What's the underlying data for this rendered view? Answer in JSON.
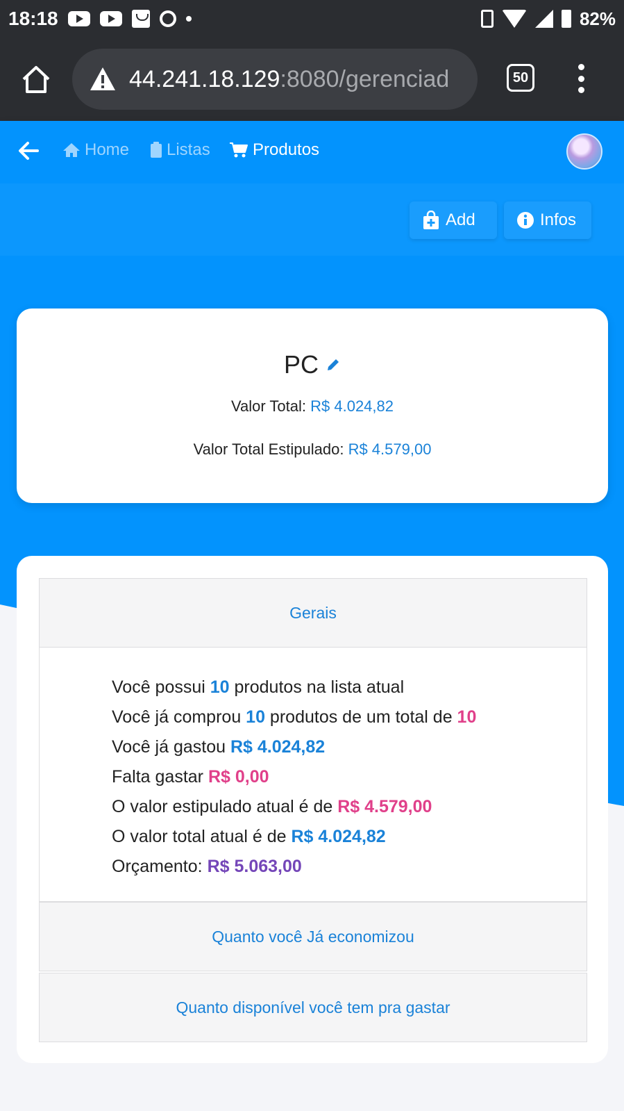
{
  "status_bar": {
    "time": "18:18",
    "battery": "82%"
  },
  "browser": {
    "url_host": "44.241.18.129",
    "url_rest": ":8080/gerenciad",
    "tab_count": "50"
  },
  "nav": {
    "home": "Home",
    "listas": "Listas",
    "produtos": "Produtos"
  },
  "actions": {
    "add": "Add",
    "infos": "Infos"
  },
  "list": {
    "name": "PC",
    "total_label": "Valor Total: ",
    "total_value": "R$ 4.024,82",
    "estimated_label": "Valor Total Estipulado: ",
    "estimated_value": "R$ 4.579,00"
  },
  "stats": {
    "section_gerais": "Gerais",
    "l1_a": "Você possui ",
    "l1_num": "10",
    "l1_b": " produtos na lista atual",
    "l2_a": "Você já comprou ",
    "l2_num": "10",
    "l2_b": " produtos de um total de ",
    "l2_total": "10",
    "l3_a": "Você já gastou ",
    "l3_val": "R$ 4.024,82",
    "l4_a": "Falta gastar ",
    "l4_val": "R$ 0,00",
    "l5_a": "O valor estipulado atual é de ",
    "l5_val": "R$ 4.579,00",
    "l6_a": "O valor total atual é de ",
    "l6_val": "R$ 4.024,82",
    "l7_a": "Orçamento: ",
    "l7_val": "R$ 5.063,00",
    "section_economizou": "Quanto você Já economizou",
    "section_disponivel": "Quanto disponível você tem pra gastar"
  },
  "colors": {
    "primary_blue": "#0393fd",
    "link_blue": "#1a82d8",
    "pink": "#e0408a",
    "purple": "#7446b8"
  }
}
